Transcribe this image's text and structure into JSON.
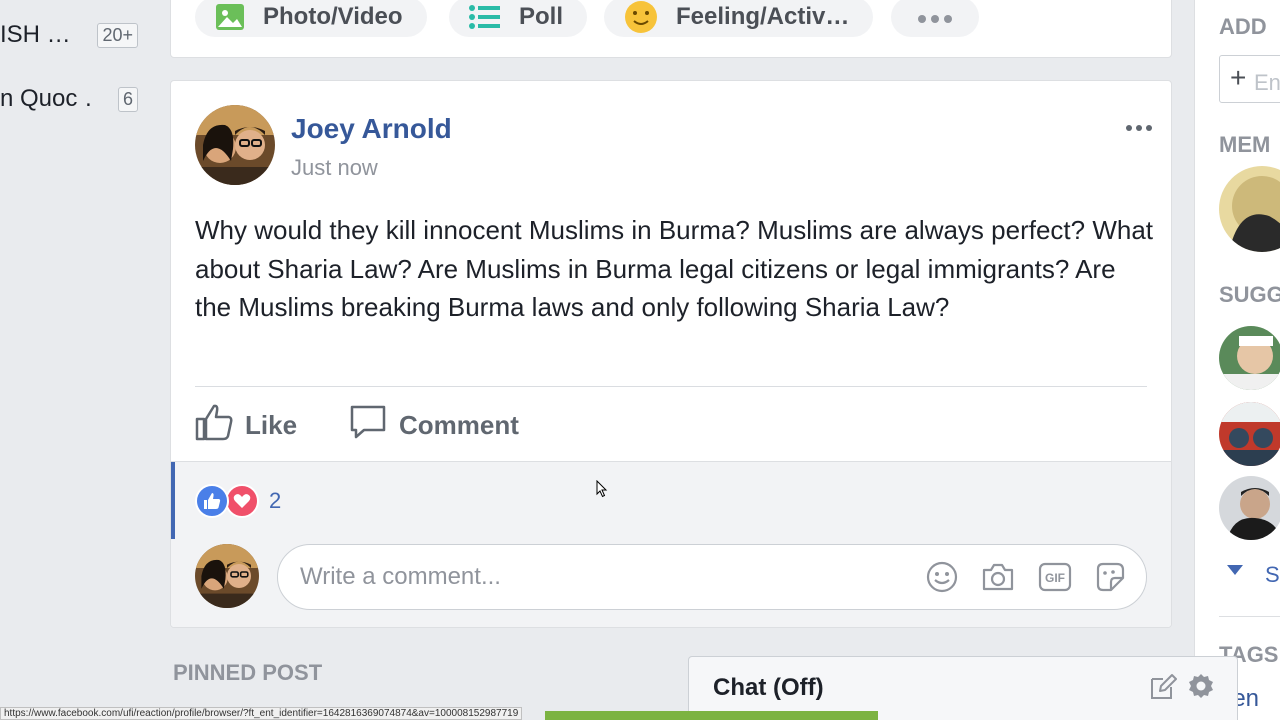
{
  "left_groups": [
    {
      "name": "ISH …",
      "badge": "20+"
    },
    {
      "name": "n Quoc …",
      "badge": "6"
    }
  ],
  "composer": {
    "photo_label": "Photo/Video",
    "poll_label": "Poll",
    "feeling_label": "Feeling/Activ…"
  },
  "post": {
    "author": "Joey Arnold",
    "time": "Just now",
    "text": "Why would they kill innocent Muslims in Burma? Muslims are always perfect? What about Sharia Law? Are Muslims in Burma legal citizens or legal immigrants? Are the Muslims breaking Burma laws and only following Sharia Law?",
    "like_label": "Like",
    "comment_label": "Comment",
    "reaction_count": "2",
    "comment_placeholder": "Write a comment..."
  },
  "pinned_label": "PINNED POST",
  "right_col": {
    "add_heading": "ADD",
    "input_placeholder": "En",
    "members_heading": "MEM",
    "suggested_heading": "SUGG",
    "see_more": "S",
    "tags_heading": "TAGS",
    "tag_partial": "rien"
  },
  "chat": {
    "label": "Chat (Off)"
  },
  "status_url": "https://www.facebook.com/ufi/reaction/profile/browser/?ft_ent_identifier=1642816369074874&av=100008152987719",
  "colors": {
    "link": "#365899",
    "accent": "#4267b2",
    "progress": "#7cb342"
  }
}
